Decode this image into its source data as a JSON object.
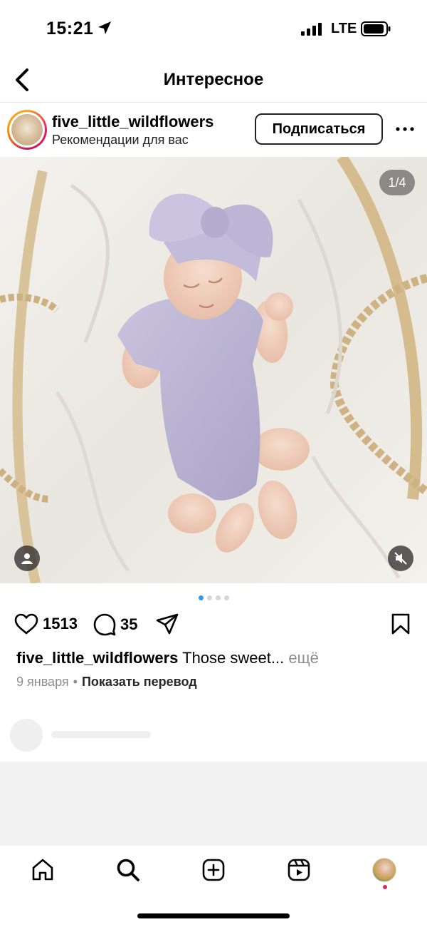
{
  "status_bar": {
    "time": "15:21",
    "network": "LTE"
  },
  "header": {
    "title": "Интересное"
  },
  "post": {
    "username": "five_little_wildflowers",
    "subtitle": "Рекомендации для вас",
    "follow_label": "Подписаться",
    "media_counter": "1/4",
    "slides_total": 4,
    "active_slide": 1,
    "likes": "1513",
    "comments": "35",
    "caption_user": "five_little_wildflowers",
    "caption_text": "Those sweet...",
    "caption_more": "ещё",
    "date": "9 января",
    "separator": "•",
    "translate_label": "Показать перевод"
  },
  "icons": {
    "back": "chevron-left-icon",
    "more": "ellipsis-icon",
    "like": "heart-icon",
    "comment": "comment-icon",
    "share": "paper-plane-icon",
    "save": "bookmark-icon",
    "tag": "person-icon",
    "mute": "speaker-muted-icon",
    "home": "home-icon",
    "search": "search-icon",
    "add": "plus-square-icon",
    "reels": "reels-icon"
  },
  "colors": {
    "active_dot": "#3897f0",
    "notification": "#e0245e"
  }
}
